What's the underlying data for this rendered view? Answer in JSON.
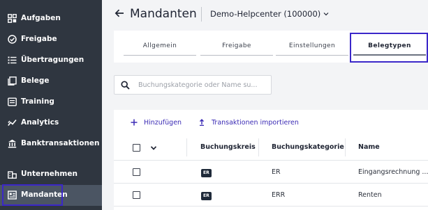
{
  "sidebar": {
    "items": [
      {
        "label": "Aufgaben",
        "icon": "dashboard-icon"
      },
      {
        "label": "Freigabe",
        "icon": "check-circle-icon"
      },
      {
        "label": "Übertragungen",
        "icon": "list-icon"
      },
      {
        "label": "Belege",
        "icon": "documents-icon"
      },
      {
        "label": "Training",
        "icon": "training-icon"
      },
      {
        "label": "Analytics",
        "icon": "analytics-icon"
      },
      {
        "label": "Banktransaktionen",
        "icon": "bank-icon"
      },
      {
        "label": "Unternehmen",
        "icon": "company-icon"
      },
      {
        "label": "Mandanten",
        "icon": "tenants-icon",
        "active": true
      }
    ]
  },
  "header": {
    "title": "Mandanten",
    "tenant": "Demo-Helpcenter (100000)"
  },
  "tabs": [
    {
      "label": "Allgemein"
    },
    {
      "label": "Freigabe"
    },
    {
      "label": "Einstellungen"
    },
    {
      "label": "Belegtypen",
      "active": true
    }
  ],
  "search": {
    "placeholder": "Buchungskategorie oder Name su..."
  },
  "actions": {
    "add": "Hinzufügen",
    "import": "Transaktionen importieren"
  },
  "table": {
    "columns": [
      "Buchungskreis",
      "Buchungskategorie",
      "Name"
    ],
    "rows": [
      {
        "badge": "ER",
        "category": "ER",
        "name": "Eingangsrechnung ..."
      },
      {
        "badge": "ER",
        "category": "ERR",
        "name": "Renten"
      }
    ]
  },
  "colors": {
    "sidebar_bg": "#2f3640",
    "accent": "#3b2bb5",
    "highlight_outline": "#3b27c9"
  }
}
